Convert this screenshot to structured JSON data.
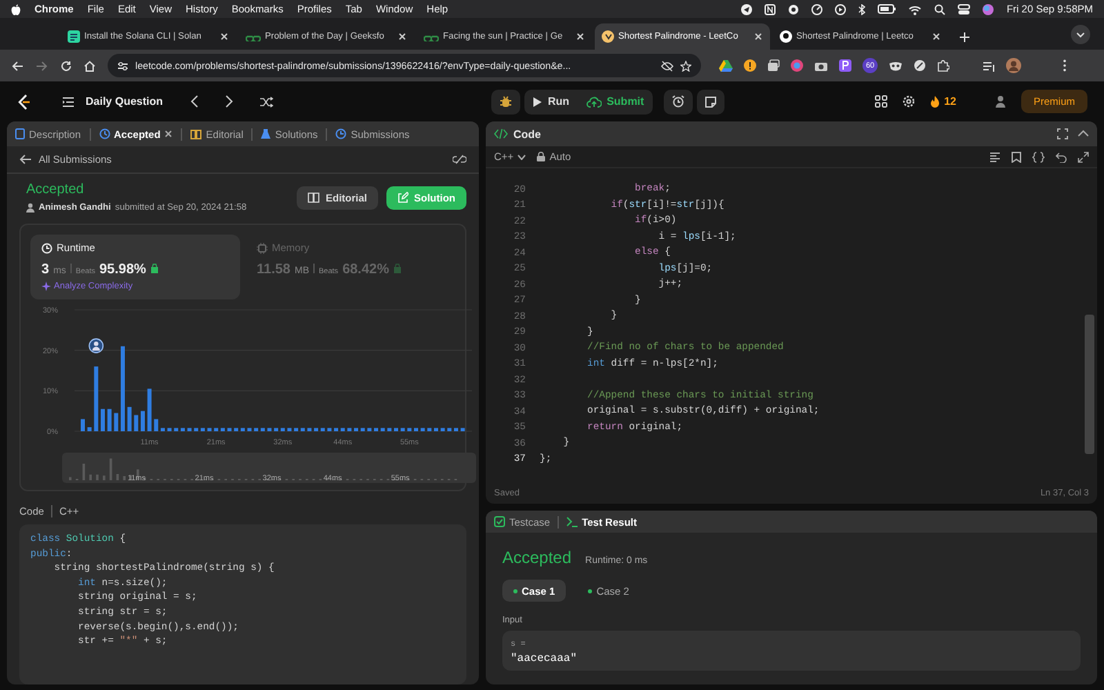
{
  "menubar": {
    "app": "Chrome",
    "menus": [
      "File",
      "Edit",
      "View",
      "History",
      "Bookmarks",
      "Profiles",
      "Tab",
      "Window",
      "Help"
    ],
    "clock": "Fri 20 Sep  9:58PM"
  },
  "browser": {
    "tabs": [
      {
        "title": "Install the Solana CLI | Solan",
        "kind": "doc",
        "selected": false
      },
      {
        "title": "Problem of the Day | Geeksfo",
        "kind": "gfg",
        "selected": false
      },
      {
        "title": "Facing the sun | Practice | Ge",
        "kind": "gfg",
        "selected": false
      },
      {
        "title": "Shortest Palindrome - LeetCo",
        "kind": "leetcode",
        "selected": true
      },
      {
        "title": "Shortest Palindrome | Leetco",
        "kind": "github",
        "selected": false
      }
    ],
    "url": "leetcode.com/problems/shortest-palindrome/submissions/1396622416/?envType=daily-question&e...",
    "extension_badge": "60"
  },
  "toolbar": {
    "title": "Daily Question",
    "run": "Run",
    "submit": "Submit",
    "streak": "12",
    "premium": "Premium"
  },
  "left_panel": {
    "tabs": [
      {
        "label": "Description",
        "kind": "description",
        "selected": false,
        "closable": false
      },
      {
        "label": "Accepted",
        "kind": "accepted",
        "selected": true,
        "closable": true
      },
      {
        "label": "Editorial",
        "kind": "editorial",
        "selected": false,
        "closable": false
      },
      {
        "label": "Solutions",
        "kind": "solutions",
        "selected": false,
        "closable": false
      },
      {
        "label": "Submissions",
        "kind": "submissions",
        "selected": false,
        "closable": false
      }
    ],
    "back": "All Submissions",
    "status": "Accepted",
    "author": "Animesh Gandhi",
    "submitted": "submitted at Sep 20, 2024 21:58",
    "buttons": [
      {
        "label": "Editorial",
        "kind": "editorial"
      },
      {
        "label": "Solution",
        "kind": "solution"
      }
    ],
    "metrics": [
      {
        "title": "Runtime",
        "kind": "runtime",
        "value": "3",
        "unit": "ms",
        "beats_label": "Beats",
        "beats": "95.98%",
        "selected": true,
        "link": "Analyze Complexity"
      },
      {
        "title": "Memory",
        "kind": "memory",
        "value": "11.58",
        "unit": "MB",
        "beats_label": "Beats",
        "beats": "68.42%",
        "selected": false
      }
    ],
    "chart_data": {
      "type": "bar",
      "ylim": [
        0,
        30
      ],
      "yticks": [
        {
          "value": 0,
          "label": "0%"
        },
        {
          "value": 10,
          "label": "10%"
        },
        {
          "value": 20,
          "label": "20%"
        },
        {
          "value": 30,
          "label": "30%"
        }
      ],
      "categories": [
        null,
        null,
        null,
        null,
        null,
        null,
        null,
        null,
        null,
        null,
        "11ms",
        null,
        null,
        null,
        null,
        null,
        null,
        null,
        null,
        null,
        "21ms",
        null,
        null,
        null,
        null,
        null,
        null,
        null,
        null,
        null,
        "32ms",
        null,
        null,
        null,
        null,
        null,
        null,
        null,
        null,
        "44ms",
        null,
        null,
        null,
        null,
        null,
        null,
        null,
        null,
        null,
        "55ms",
        null,
        null,
        null,
        null,
        null,
        null,
        null,
        null
      ],
      "values": [
        3,
        1,
        16,
        5.5,
        5.5,
        4.5,
        21,
        6,
        4,
        5,
        10.5,
        3,
        0.8,
        0.8,
        0.8,
        0.8,
        0.8,
        0.8,
        0.8,
        0.8,
        0.8,
        0.8,
        0.8,
        0.8,
        0.8,
        0.8,
        0.8,
        0.8,
        0.8,
        0.8,
        0.8,
        0.8,
        0.8,
        0.8,
        0.8,
        0.8,
        0.8,
        0.8,
        0.8,
        0.8,
        0.8,
        0.8,
        0.8,
        0.8,
        0.8,
        0.8,
        0.8,
        0.8,
        0.8,
        0.8,
        0.8,
        0.8,
        0.8,
        0.8,
        0.8,
        0.8,
        0.8,
        0.8
      ]
    },
    "overview_labels": [
      "11ms",
      "21ms",
      "32ms",
      "44ms",
      "55ms"
    ],
    "code_label": "Code",
    "code_lang": "C++",
    "code": [
      {
        "tokens": [
          {
            "kind": "type",
            "text": "class"
          },
          {
            "kind": "class",
            "text": " Solution"
          },
          {
            "kind": "plain",
            "text": " {"
          }
        ]
      },
      {
        "tokens": [
          {
            "kind": "type",
            "text": "public"
          },
          {
            "kind": "plain",
            "text": ":"
          }
        ]
      },
      {
        "tokens": [
          {
            "kind": "plain",
            "text": "    string shortestPalindrome(string s) {"
          }
        ]
      },
      {
        "tokens": [
          {
            "kind": "type",
            "text": "        int"
          },
          {
            "kind": "plain",
            "text": " n=s.size();"
          }
        ]
      },
      {
        "tokens": [
          {
            "kind": "plain",
            "text": "        string original = s;"
          }
        ]
      },
      {
        "tokens": [
          {
            "kind": "plain",
            "text": "        string str = s;"
          }
        ]
      },
      {
        "tokens": [
          {
            "kind": "plain",
            "text": "        reverse(s.begin(),s.end());"
          }
        ]
      },
      {
        "tokens": [
          {
            "kind": "plain",
            "text": "        str += "
          },
          {
            "kind": "string",
            "text": "\"*\""
          },
          {
            "kind": "plain",
            "text": " + s;"
          }
        ]
      }
    ]
  },
  "editor": {
    "title": "Code",
    "language": "C++",
    "mode": "Auto",
    "status": "Saved",
    "cursor": "Ln 37, Col 3",
    "lines": [
      {
        "n": "20",
        "current": false,
        "tokens": [
          {
            "kind": "keyword",
            "text": "                break"
          },
          {
            "kind": "plain",
            "text": ";"
          }
        ]
      },
      {
        "n": "21",
        "current": false,
        "tokens": [
          {
            "kind": "keyword",
            "text": "            if"
          },
          {
            "kind": "plain",
            "text": "("
          },
          {
            "kind": "variable",
            "text": "str"
          },
          {
            "kind": "plain",
            "text": "[i]!="
          },
          {
            "kind": "variable",
            "text": "str"
          },
          {
            "kind": "plain",
            "text": "[j]){"
          }
        ]
      },
      {
        "n": "22",
        "current": false,
        "tokens": [
          {
            "kind": "keyword",
            "text": "                if"
          },
          {
            "kind": "plain",
            "text": "(i>0)"
          }
        ]
      },
      {
        "n": "23",
        "current": false,
        "tokens": [
          {
            "kind": "plain",
            "text": "                    i = "
          },
          {
            "kind": "variable",
            "text": "lps"
          },
          {
            "kind": "plain",
            "text": "[i-1];"
          }
        ]
      },
      {
        "n": "24",
        "current": false,
        "tokens": [
          {
            "kind": "keyword",
            "text": "                else"
          },
          {
            "kind": "plain",
            "text": " {"
          }
        ]
      },
      {
        "n": "25",
        "current": false,
        "tokens": [
          {
            "kind": "variable",
            "text": "                    lps"
          },
          {
            "kind": "plain",
            "text": "[j]=0;"
          }
        ]
      },
      {
        "n": "26",
        "current": false,
        "tokens": [
          {
            "kind": "plain",
            "text": "                    j++;"
          }
        ]
      },
      {
        "n": "27",
        "current": false,
        "tokens": [
          {
            "kind": "plain",
            "text": "                }"
          }
        ]
      },
      {
        "n": "28",
        "current": false,
        "tokens": [
          {
            "kind": "plain",
            "text": "            }"
          }
        ]
      },
      {
        "n": "29",
        "current": false,
        "tokens": [
          {
            "kind": "plain",
            "text": "        }"
          }
        ]
      },
      {
        "n": "30",
        "current": false,
        "tokens": [
          {
            "kind": "comment",
            "text": "        //Find no of chars to be appended"
          }
        ]
      },
      {
        "n": "31",
        "current": false,
        "tokens": [
          {
            "kind": "type",
            "text": "        int"
          },
          {
            "kind": "plain",
            "text": " diff = n-lps[2*n];"
          }
        ]
      },
      {
        "n": "32",
        "current": false
      },
      {
        "n": "33",
        "current": false,
        "tokens": [
          {
            "kind": "comment",
            "text": "        //Append these chars to initial string"
          }
        ]
      },
      {
        "n": "34",
        "current": false,
        "tokens": [
          {
            "kind": "plain",
            "text": "        original = s.substr(0,diff) + original;"
          }
        ]
      },
      {
        "n": "35",
        "current": false,
        "tokens": [
          {
            "kind": "keyword",
            "text": "        return"
          },
          {
            "kind": "plain",
            "text": " original;"
          }
        ]
      },
      {
        "n": "36",
        "current": false,
        "tokens": [
          {
            "kind": "plain",
            "text": "    }"
          }
        ]
      },
      {
        "n": "37",
        "current": true,
        "tokens": [
          {
            "kind": "plain",
            "text": "};"
          }
        ]
      }
    ]
  },
  "results": {
    "tabs": [
      {
        "label": "Testcase",
        "kind": "testcase",
        "selected": false
      },
      {
        "label": "Test Result",
        "kind": "result",
        "selected": true
      }
    ],
    "verdict": "Accepted",
    "runtime": "Runtime: 0 ms",
    "cases": [
      {
        "label": "Case 1",
        "selected": true
      },
      {
        "label": "Case 2",
        "selected": false
      }
    ],
    "input_label": "Input",
    "inputs": [
      {
        "name": "s =",
        "value": "\"aacecaaa\""
      }
    ]
  }
}
